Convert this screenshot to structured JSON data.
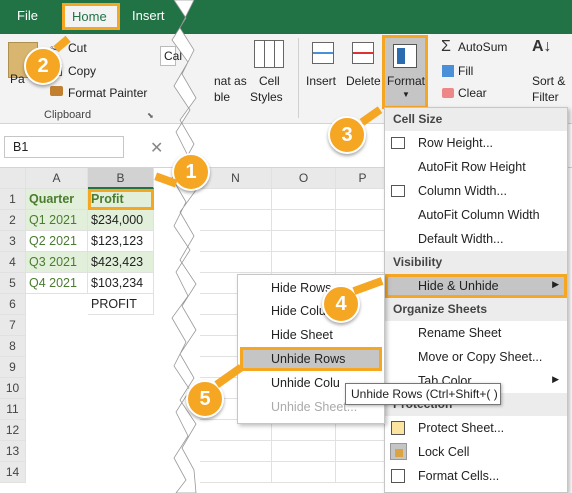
{
  "tabs": [
    "File",
    "Home",
    "Insert"
  ],
  "ribbon": {
    "cut": "Cut",
    "copy": "Copy",
    "format_painter": "Format Painter",
    "clipboard": "Clipboard",
    "paste_short": "Pa",
    "font_box": "Cal",
    "format_as_1": "nat as",
    "format_as_2": "ble",
    "cell_styles_1": "Cell",
    "cell_styles_2": "Styles",
    "insert": "Insert",
    "delete": "Delete",
    "format": "Format",
    "autosum": "AutoSum",
    "fill": "Fill",
    "clear": "Clear",
    "sort_1": "Sort &",
    "sort_2": "Filter"
  },
  "namebox": "B1",
  "columns_left": [
    "A",
    "B"
  ],
  "columns_right": [
    "N",
    "O",
    "P"
  ],
  "rows": [
    "1",
    "2",
    "3",
    "4",
    "5",
    "6",
    "7",
    "8",
    "9",
    "10",
    "11",
    "12",
    "13",
    "14"
  ],
  "cells": {
    "a": [
      "Quarter",
      "Q1 2021",
      "Q2 2021",
      "Q3 2021",
      "Q4 2021"
    ],
    "b": [
      "Profit",
      "$234,000",
      "$123,123",
      "$423,423",
      "$103,234",
      "PROFIT"
    ]
  },
  "format_menu": {
    "cell_size": "Cell Size",
    "row_height": "Row Height...",
    "autofit_row": "AutoFit Row Height",
    "column_width": "Column Width...",
    "autofit_col": "AutoFit Column Width",
    "default_width": "Default Width...",
    "visibility": "Visibility",
    "hide_unhide": "Hide & Unhide",
    "organize": "Organize Sheets",
    "rename": "Rename Sheet",
    "move_copy": "Move or Copy Sheet...",
    "tab_color": "Tab Color",
    "protection": "Protection",
    "protect": "Protect Sheet...",
    "lock": "Lock Cell",
    "format_cells": "Format Cells..."
  },
  "sub_menu": {
    "hide_rows": "Hide Rows",
    "hide_cols": "Hide Colu",
    "hide_sheet": "Hide Sheet",
    "unhide_rows": "Unhide Rows",
    "unhide_cols": "Unhide Colu",
    "unhide_sheet": "Unhide Sheet..."
  },
  "tooltip": "Unhide Rows (Ctrl+Shift+( )",
  "badges": [
    "1",
    "2",
    "3",
    "4",
    "5"
  ],
  "colors": {
    "excel_green": "#217346",
    "highlight": "#f5a623",
    "green_text": "#4a7c2f",
    "green_fill": "#e2efda"
  }
}
